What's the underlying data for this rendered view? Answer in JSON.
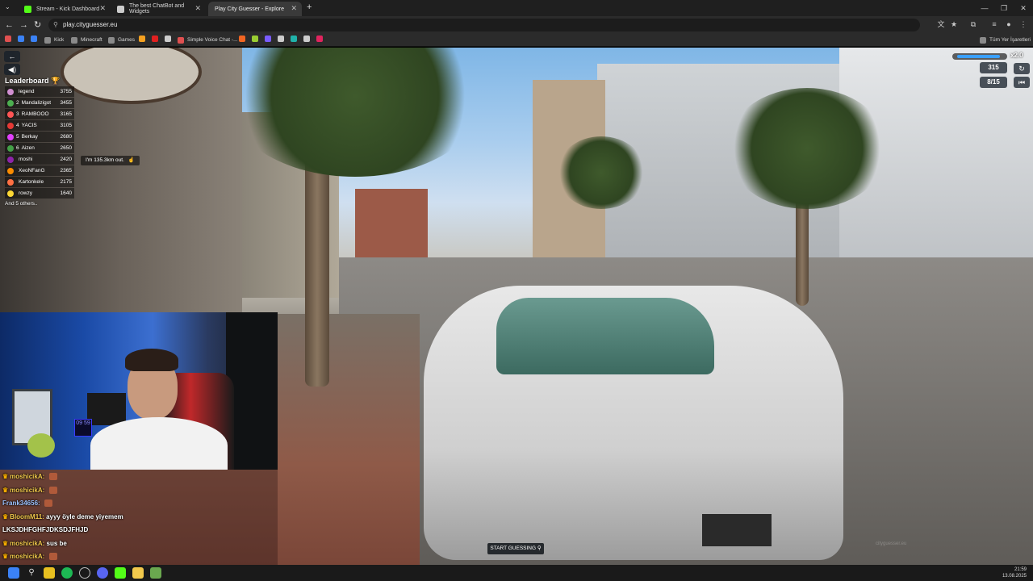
{
  "browser": {
    "tabs": [
      {
        "label": "Stream - Kick Dashboard",
        "color": "#53fc18",
        "active": false
      },
      {
        "label": "The best ChatBot and Widgets",
        "color": "#cccccc",
        "active": false
      },
      {
        "label": "Play City Guesser - Explore",
        "color": "#3b82f6",
        "active": true
      }
    ],
    "new_tab": "+",
    "url": "play.cityguesser.eu",
    "bookmarks": [
      {
        "label": "Kick",
        "color": "#53fc18"
      },
      {
        "label": "Minecraft",
        "color": "#888888"
      },
      {
        "label": "Games",
        "color": "#888888"
      },
      {
        "label": "Simple Voice Chat -...",
        "color": "#e05050"
      }
    ],
    "all_bookmarks": "Tüm Yer İşaretleri"
  },
  "game": {
    "leaderboard_title": "Leaderboard",
    "leaderboard": [
      {
        "rank": "",
        "name": "legend",
        "score": "3755",
        "color": "#d18fd1"
      },
      {
        "rank": "2",
        "name": "Mandalizigot",
        "score": "3455",
        "color": "#4caf50"
      },
      {
        "rank": "3",
        "name": "RAMBOOO",
        "score": "3165",
        "color": "#ff5555"
      },
      {
        "rank": "4",
        "name": "YACIS",
        "score": "3105",
        "color": "#e53935"
      },
      {
        "rank": "5",
        "name": "Berkay",
        "score": "2680",
        "color": "#e040fb"
      },
      {
        "rank": "6",
        "name": "Aizen",
        "score": "2650",
        "color": "#43a047"
      },
      {
        "rank": "",
        "name": "moshi",
        "score": "2420",
        "color": "#8e24aa"
      },
      {
        "rank": "",
        "name": "XeoNFanG",
        "score": "2365",
        "color": "#fb8c00"
      },
      {
        "rank": "",
        "name": "Kartonkele",
        "score": "2175",
        "color": "#ff7043"
      },
      {
        "rank": "",
        "name": "rowzy",
        "score": "1640",
        "color": "#fdd835"
      }
    ],
    "leaderboard_more": "And 5 others..",
    "distance_tip": "I'm 135.3km out.",
    "zoom_label": "x2.0",
    "zoom_level": 0.85,
    "score_value": "315",
    "round_label": "8/15",
    "start_guessing": "START GUESSING",
    "watermark": "cityguesser.eu"
  },
  "chat": [
    {
      "user": "moshicikA:",
      "message": "",
      "crown": true,
      "emote": true,
      "blue": false
    },
    {
      "user": "moshicikA:",
      "message": "",
      "crown": true,
      "emote": true,
      "blue": false
    },
    {
      "user": "Frank34656:",
      "message": "",
      "crown": false,
      "emote": true,
      "blue": true
    },
    {
      "user": "BloomM11:",
      "message": "ayyy öyle deme yiyemem",
      "crown": true,
      "emote": false,
      "blue": false
    },
    {
      "user": "",
      "message": "LKSJDHFGHFJDKSDJFHJD",
      "crown": false,
      "emote": false,
      "blue": false
    },
    {
      "user": "moshicikA:",
      "message": "sus be",
      "crown": true,
      "emote": false,
      "blue": false
    },
    {
      "user": "moshicikA:",
      "message": "",
      "crown": true,
      "emote": true,
      "blue": false
    }
  ],
  "webcam": {
    "clock_display": "09 59"
  },
  "taskbar": {
    "time": "21:59",
    "date": "13.08.2025"
  }
}
